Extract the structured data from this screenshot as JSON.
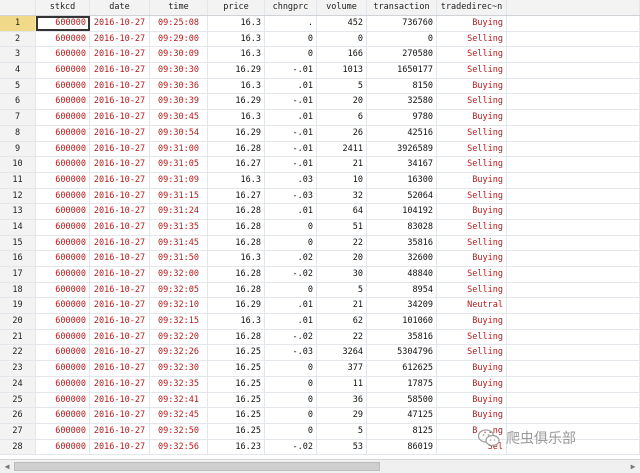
{
  "columns": [
    "stkcd",
    "date",
    "time",
    "price",
    "chngprc",
    "volume",
    "transaction",
    "tradedirec~n"
  ],
  "rows": [
    {
      "n": "1",
      "stkcd": "600000",
      "date": "2016-10-27",
      "time": "09:25:08",
      "price": "16.3",
      "chngprc": ".",
      "volume": "452",
      "transaction": "736760",
      "dir": "Buying"
    },
    {
      "n": "2",
      "stkcd": "600000",
      "date": "2016-10-27",
      "time": "09:29:00",
      "price": "16.3",
      "chngprc": "0",
      "volume": "0",
      "transaction": "0",
      "dir": "Selling"
    },
    {
      "n": "3",
      "stkcd": "600000",
      "date": "2016-10-27",
      "time": "09:30:09",
      "price": "16.3",
      "chngprc": "0",
      "volume": "166",
      "transaction": "270580",
      "dir": "Selling"
    },
    {
      "n": "4",
      "stkcd": "600000",
      "date": "2016-10-27",
      "time": "09:30:30",
      "price": "16.29",
      "chngprc": "-.01",
      "volume": "1013",
      "transaction": "1650177",
      "dir": "Selling"
    },
    {
      "n": "5",
      "stkcd": "600000",
      "date": "2016-10-27",
      "time": "09:30:36",
      "price": "16.3",
      "chngprc": ".01",
      "volume": "5",
      "transaction": "8150",
      "dir": "Buying"
    },
    {
      "n": "6",
      "stkcd": "600000",
      "date": "2016-10-27",
      "time": "09:30:39",
      "price": "16.29",
      "chngprc": "-.01",
      "volume": "20",
      "transaction": "32580",
      "dir": "Selling"
    },
    {
      "n": "7",
      "stkcd": "600000",
      "date": "2016-10-27",
      "time": "09:30:45",
      "price": "16.3",
      "chngprc": ".01",
      "volume": "6",
      "transaction": "9780",
      "dir": "Buying"
    },
    {
      "n": "8",
      "stkcd": "600000",
      "date": "2016-10-27",
      "time": "09:30:54",
      "price": "16.29",
      "chngprc": "-.01",
      "volume": "26",
      "transaction": "42516",
      "dir": "Selling"
    },
    {
      "n": "9",
      "stkcd": "600000",
      "date": "2016-10-27",
      "time": "09:31:00",
      "price": "16.28",
      "chngprc": "-.01",
      "volume": "2411",
      "transaction": "3926589",
      "dir": "Selling"
    },
    {
      "n": "10",
      "stkcd": "600000",
      "date": "2016-10-27",
      "time": "09:31:05",
      "price": "16.27",
      "chngprc": "-.01",
      "volume": "21",
      "transaction": "34167",
      "dir": "Selling"
    },
    {
      "n": "11",
      "stkcd": "600000",
      "date": "2016-10-27",
      "time": "09:31:09",
      "price": "16.3",
      "chngprc": ".03",
      "volume": "10",
      "transaction": "16300",
      "dir": "Buying"
    },
    {
      "n": "12",
      "stkcd": "600000",
      "date": "2016-10-27",
      "time": "09:31:15",
      "price": "16.27",
      "chngprc": "-.03",
      "volume": "32",
      "transaction": "52064",
      "dir": "Selling"
    },
    {
      "n": "13",
      "stkcd": "600000",
      "date": "2016-10-27",
      "time": "09:31:24",
      "price": "16.28",
      "chngprc": ".01",
      "volume": "64",
      "transaction": "104192",
      "dir": "Buying"
    },
    {
      "n": "14",
      "stkcd": "600000",
      "date": "2016-10-27",
      "time": "09:31:35",
      "price": "16.28",
      "chngprc": "0",
      "volume": "51",
      "transaction": "83028",
      "dir": "Selling"
    },
    {
      "n": "15",
      "stkcd": "600000",
      "date": "2016-10-27",
      "time": "09:31:45",
      "price": "16.28",
      "chngprc": "0",
      "volume": "22",
      "transaction": "35816",
      "dir": "Selling"
    },
    {
      "n": "16",
      "stkcd": "600000",
      "date": "2016-10-27",
      "time": "09:31:50",
      "price": "16.3",
      "chngprc": ".02",
      "volume": "20",
      "transaction": "32600",
      "dir": "Buying"
    },
    {
      "n": "17",
      "stkcd": "600000",
      "date": "2016-10-27",
      "time": "09:32:00",
      "price": "16.28",
      "chngprc": "-.02",
      "volume": "30",
      "transaction": "48840",
      "dir": "Selling"
    },
    {
      "n": "18",
      "stkcd": "600000",
      "date": "2016-10-27",
      "time": "09:32:05",
      "price": "16.28",
      "chngprc": "0",
      "volume": "5",
      "transaction": "8954",
      "dir": "Selling"
    },
    {
      "n": "19",
      "stkcd": "600000",
      "date": "2016-10-27",
      "time": "09:32:10",
      "price": "16.29",
      "chngprc": ".01",
      "volume": "21",
      "transaction": "34209",
      "dir": "Neutral"
    },
    {
      "n": "20",
      "stkcd": "600000",
      "date": "2016-10-27",
      "time": "09:32:15",
      "price": "16.3",
      "chngprc": ".01",
      "volume": "62",
      "transaction": "101060",
      "dir": "Buying"
    },
    {
      "n": "21",
      "stkcd": "600000",
      "date": "2016-10-27",
      "time": "09:32:20",
      "price": "16.28",
      "chngprc": "-.02",
      "volume": "22",
      "transaction": "35816",
      "dir": "Selling"
    },
    {
      "n": "22",
      "stkcd": "600000",
      "date": "2016-10-27",
      "time": "09:32:26",
      "price": "16.25",
      "chngprc": "-.03",
      "volume": "3264",
      "transaction": "5304796",
      "dir": "Selling"
    },
    {
      "n": "23",
      "stkcd": "600000",
      "date": "2016-10-27",
      "time": "09:32:30",
      "price": "16.25",
      "chngprc": "0",
      "volume": "377",
      "transaction": "612625",
      "dir": "Buying"
    },
    {
      "n": "24",
      "stkcd": "600000",
      "date": "2016-10-27",
      "time": "09:32:35",
      "price": "16.25",
      "chngprc": "0",
      "volume": "11",
      "transaction": "17875",
      "dir": "Buying"
    },
    {
      "n": "25",
      "stkcd": "600000",
      "date": "2016-10-27",
      "time": "09:32:41",
      "price": "16.25",
      "chngprc": "0",
      "volume": "36",
      "transaction": "58500",
      "dir": "Buying"
    },
    {
      "n": "26",
      "stkcd": "600000",
      "date": "2016-10-27",
      "time": "09:32:45",
      "price": "16.25",
      "chngprc": "0",
      "volume": "29",
      "transaction": "47125",
      "dir": "Buying"
    },
    {
      "n": "27",
      "stkcd": "600000",
      "date": "2016-10-27",
      "time": "09:32:50",
      "price": "16.25",
      "chngprc": "0",
      "volume": "5",
      "transaction": "8125",
      "dir": "B...ng"
    },
    {
      "n": "28",
      "stkcd": "600000",
      "date": "2016-10-27",
      "time": "09:32:56",
      "price": "16.23",
      "chngprc": "-.02",
      "volume": "53",
      "transaction": "86019",
      "dir": "Sel"
    }
  ],
  "watermark": {
    "text": "爬虫俱乐部",
    "icon": "wechat-icon"
  },
  "colors": {
    "string_red": "#b31b1b",
    "selected_rowhead": "#f1d98a",
    "header_bg": "#f3f3f3"
  },
  "selection": {
    "row": "1",
    "column": "stkcd"
  }
}
